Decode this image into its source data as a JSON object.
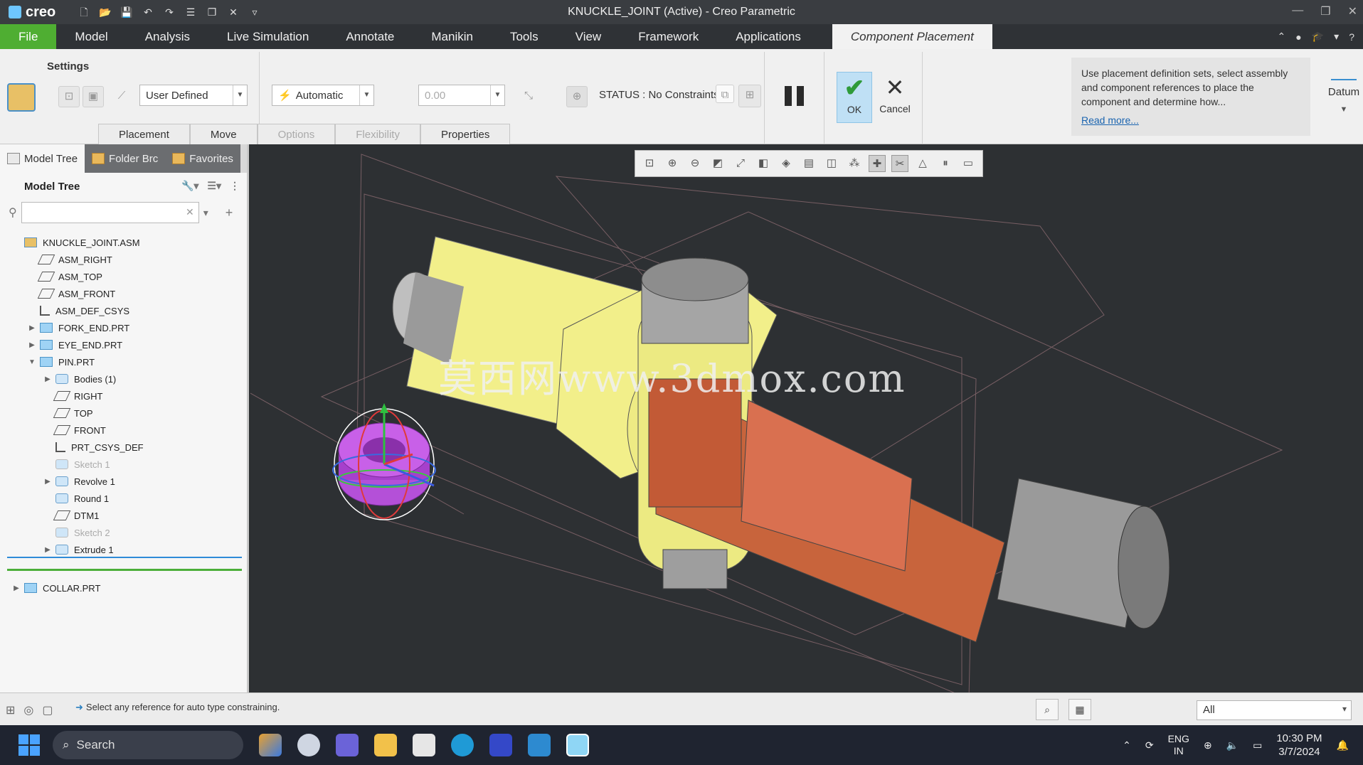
{
  "titlebar": {
    "logo": "creo",
    "title": "KNUCKLE_JOINT (Active) - Creo Parametric"
  },
  "ribbon_tabs": [
    {
      "label": "File"
    },
    {
      "label": "Model"
    },
    {
      "label": "Analysis"
    },
    {
      "label": "Live Simulation"
    },
    {
      "label": "Annotate"
    },
    {
      "label": "Manikin"
    },
    {
      "label": "Tools"
    },
    {
      "label": "View"
    },
    {
      "label": "Framework"
    },
    {
      "label": "Applications"
    },
    {
      "label": "Component Placement"
    }
  ],
  "ribbon": {
    "settings_label": "Settings",
    "constraint_type": "User Defined",
    "auto_mode": "Automatic",
    "offset_value": "0.00",
    "status": "STATUS : No Constraints",
    "ok_label": "OK",
    "cancel_label": "Cancel",
    "help_text": "Use placement definition sets, select assembly and component references to place the component and determine how...",
    "read_more": "Read more...",
    "datum_label": "Datum",
    "subtabs": [
      {
        "label": "Placement",
        "enabled": true
      },
      {
        "label": "Move",
        "enabled": true
      },
      {
        "label": "Options",
        "enabled": false
      },
      {
        "label": "Flexibility",
        "enabled": false
      },
      {
        "label": "Properties",
        "enabled": true
      }
    ]
  },
  "left_panel": {
    "tabs": [
      {
        "label": "Model Tree"
      },
      {
        "label": "Folder Brc"
      },
      {
        "label": "Favorites"
      }
    ],
    "tree_title": "Model Tree",
    "filter_placeholder": "",
    "nodes": [
      {
        "label": "KNUCKLE_JOINT.ASM",
        "level": 0,
        "icon": "assembly-icon",
        "expander": "",
        "dim": false
      },
      {
        "label": "ASM_RIGHT",
        "level": 1,
        "icon": "datum-plane-icon",
        "expander": "",
        "dim": false
      },
      {
        "label": "ASM_TOP",
        "level": 1,
        "icon": "datum-plane-icon",
        "expander": "",
        "dim": false
      },
      {
        "label": "ASM_FRONT",
        "level": 1,
        "icon": "datum-plane-icon",
        "expander": "",
        "dim": false
      },
      {
        "label": "ASM_DEF_CSYS",
        "level": 1,
        "icon": "csys-icon",
        "expander": "",
        "dim": false
      },
      {
        "label": "FORK_END.PRT",
        "level": 1,
        "icon": "part-icon",
        "expander": "▶",
        "dim": false
      },
      {
        "label": "EYE_END.PRT",
        "level": 1,
        "icon": "part-icon",
        "expander": "▶",
        "dim": false
      },
      {
        "label": "PIN.PRT",
        "level": 1,
        "icon": "part-icon",
        "expander": "▼",
        "dim": false
      },
      {
        "label": "Bodies (1)",
        "level": 2,
        "icon": "bodies-icon",
        "expander": "▶",
        "dim": false
      },
      {
        "label": "RIGHT",
        "level": 2,
        "icon": "datum-plane-icon",
        "expander": "",
        "dim": false
      },
      {
        "label": "TOP",
        "level": 2,
        "icon": "datum-plane-icon",
        "expander": "",
        "dim": false
      },
      {
        "label": "FRONT",
        "level": 2,
        "icon": "datum-plane-icon",
        "expander": "",
        "dim": false
      },
      {
        "label": "PRT_CSYS_DEF",
        "level": 2,
        "icon": "csys-icon",
        "expander": "",
        "dim": false
      },
      {
        "label": "Sketch 1",
        "level": 2,
        "icon": "sketch-icon",
        "expander": "",
        "dim": true
      },
      {
        "label": "Revolve 1",
        "level": 2,
        "icon": "revolve-icon",
        "expander": "▶",
        "dim": false
      },
      {
        "label": "Round 1",
        "level": 2,
        "icon": "round-icon",
        "expander": "",
        "dim": false
      },
      {
        "label": "DTM1",
        "level": 2,
        "icon": "datum-plane-icon",
        "expander": "",
        "dim": false
      },
      {
        "label": "Sketch 2",
        "level": 2,
        "icon": "sketch-icon",
        "expander": "",
        "dim": true
      },
      {
        "label": "Extrude 1",
        "level": 2,
        "icon": "extrude-icon",
        "expander": "▶",
        "dim": false
      }
    ],
    "collar_node": {
      "label": "COLLAR.PRT",
      "icon": "part-icon",
      "expander": "▶"
    }
  },
  "viewport": {
    "watermark": "莫西网www.3dmox.com"
  },
  "statusbar": {
    "message": "Select any reference for auto type constraining.",
    "filter_value": "All"
  },
  "taskbar": {
    "search_label": "Search",
    "lang_line1": "ENG",
    "lang_line2": "IN",
    "time": "10:30 PM",
    "date": "3/7/2024"
  },
  "colors": {
    "file_tab": "#4fae32",
    "fork_end": "#f2ef8a",
    "eye_end": "#c8643c",
    "pin": "#9a9a9a",
    "collar": "#b450d8",
    "viewport_bg": "#2d3033"
  }
}
